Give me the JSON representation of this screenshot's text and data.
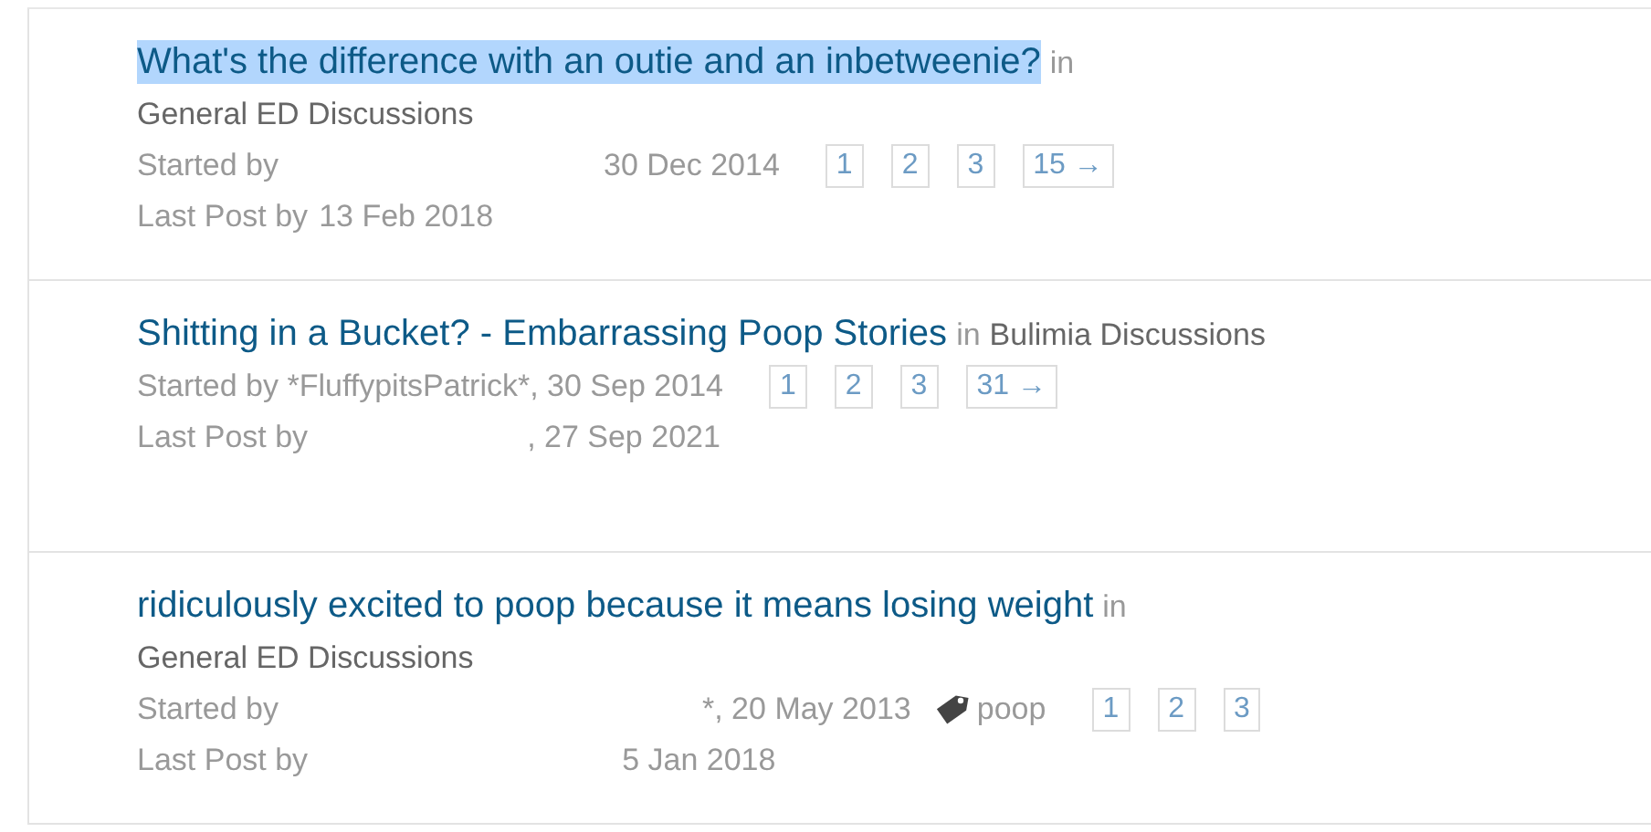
{
  "threads": [
    {
      "title": "What's the difference with an outie and an inbetweenie?",
      "highlighted": true,
      "in": "in",
      "forum": "General ED Discussions",
      "started": [
        "Started by",
        "30 Dec 2014"
      ],
      "last_post": [
        "Last Post by",
        "13 Feb 2018"
      ],
      "pages": [
        "1",
        "2",
        "3",
        "15 →"
      ]
    },
    {
      "title": "Shitting in a Bucket? - Embarrassing Poop Stories",
      "highlighted": false,
      "in": "in",
      "forum": "Bulimia Discussions",
      "started": [
        "Started by *FluffypitsPatrick*, 30 Sep 2014"
      ],
      "last_post": [
        "Last Post by",
        ", 27 Sep 2021"
      ],
      "pages": [
        "1",
        "2",
        "3",
        "31 →"
      ]
    },
    {
      "title": "ridiculously excited to poop because it means losing weight",
      "highlighted": false,
      "in": "in",
      "forum": "General ED Discussions",
      "started": [
        "Started by",
        "*, 20 May 2013"
      ],
      "tag": "poop",
      "last_post": [
        "Last Post by",
        "5 Jan 2018"
      ],
      "pages": [
        "1",
        "2",
        "3"
      ]
    }
  ]
}
